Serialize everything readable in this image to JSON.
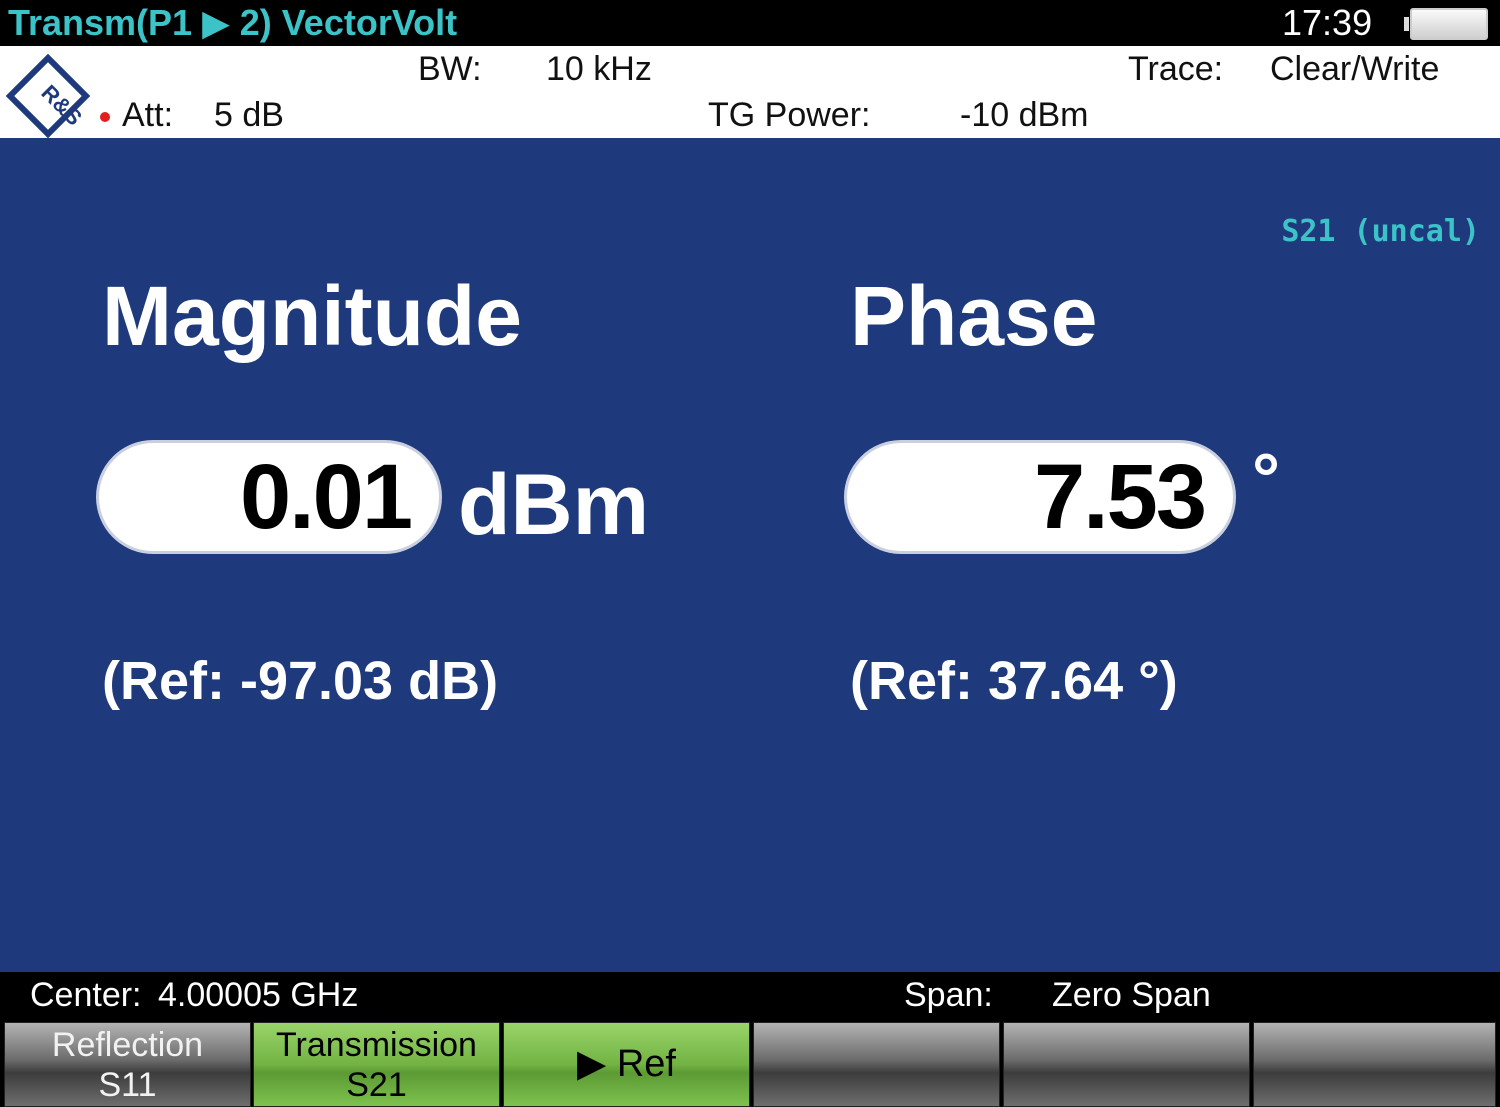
{
  "titlebar": {
    "title": "Transm(P1 ▶ 2) VectorVolt",
    "clock": "17:39"
  },
  "infobar": {
    "bw_label": "BW:",
    "bw_value": "10 kHz",
    "trace_label": "Trace:",
    "trace_value": "Clear/Write",
    "att_label": "Att:",
    "att_value": "5 dB",
    "tg_label": "TG Power:",
    "tg_value": "-10 dBm",
    "logo_text": "R&S"
  },
  "main": {
    "calibration": "S21 (uncal)",
    "magnitude": {
      "heading": "Magnitude",
      "value": "0.01",
      "unit": "dBm",
      "ref": "(Ref: -97.03 dB)"
    },
    "phase": {
      "heading": "Phase",
      "value": "7.53",
      "unit": "°",
      "ref": "(Ref: 37.64 °)"
    }
  },
  "statusbar": {
    "center_label": "Center:",
    "center_value": "4.00005 GHz",
    "span_label": "Span:",
    "span_value": "Zero Span"
  },
  "softkeys": [
    {
      "line1": "Reflection",
      "line2": "S11",
      "style": "gray"
    },
    {
      "line1": "Transmission",
      "line2": "S21",
      "style": "green"
    },
    {
      "label": "▶  Ref",
      "style": "green"
    },
    {
      "label": "",
      "style": "gray"
    },
    {
      "label": "",
      "style": "gray"
    },
    {
      "label": "",
      "style": "gray"
    }
  ],
  "colors": {
    "panel_bg": "#1e3a7c",
    "title_accent": "#3cc3c8",
    "softkey_active": "#72b343"
  }
}
